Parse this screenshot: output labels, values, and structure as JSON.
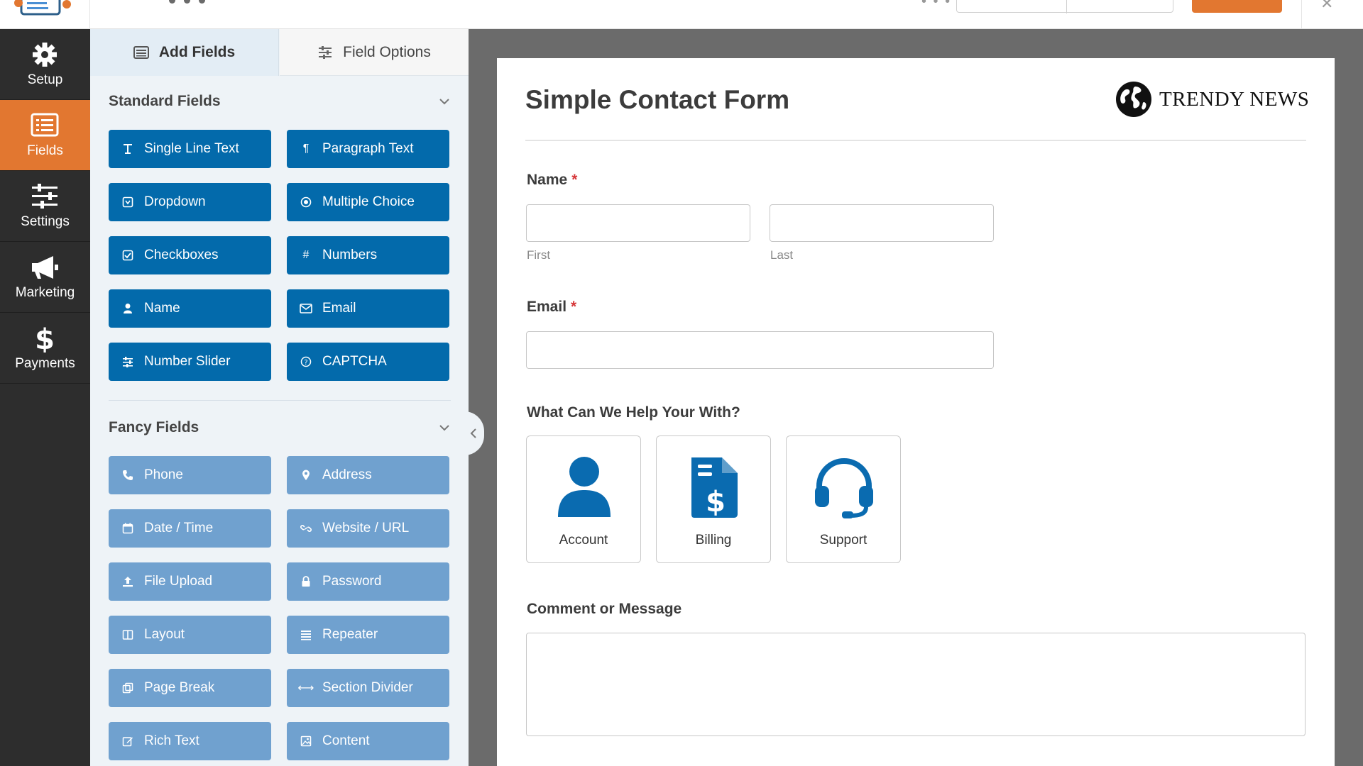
{
  "nav": {
    "items": [
      {
        "label": "Setup",
        "icon": "gear-icon"
      },
      {
        "label": "Fields",
        "icon": "list-icon",
        "active": true
      },
      {
        "label": "Settings",
        "icon": "sliders-icon"
      },
      {
        "label": "Marketing",
        "icon": "megaphone-icon"
      },
      {
        "label": "Payments",
        "icon": "dollar-icon"
      }
    ]
  },
  "panel": {
    "tabs": {
      "add_fields": "Add Fields",
      "field_options": "Field Options"
    },
    "standard": {
      "title": "Standard Fields",
      "fields": [
        "Single Line Text",
        "Paragraph Text",
        "Dropdown",
        "Multiple Choice",
        "Checkboxes",
        "Numbers",
        "Name",
        "Email",
        "Number Slider",
        "CAPTCHA"
      ]
    },
    "fancy": {
      "title": "Fancy Fields",
      "fields": [
        "Phone",
        "Address",
        "Date / Time",
        "Website / URL",
        "File Upload",
        "Password",
        "Layout",
        "Repeater",
        "Page Break",
        "Section Divider",
        "Rich Text",
        "Content"
      ]
    }
  },
  "form": {
    "title": "Simple Contact Form",
    "brand": "TRENDY NEWS",
    "name_label": "Name",
    "required_mark": "*",
    "first_sublabel": "First",
    "last_sublabel": "Last",
    "email_label": "Email",
    "help_label": "What Can We Help Your With?",
    "choices": [
      {
        "label": "Account",
        "icon": "user-icon"
      },
      {
        "label": "Billing",
        "icon": "invoice-dollar-icon"
      },
      {
        "label": "Support",
        "icon": "headset-icon"
      }
    ],
    "comment_label": "Comment or Message"
  },
  "colors": {
    "accent_orange": "#e27730",
    "standard_button": "#036aab",
    "fancy_button": "#70a1cf",
    "nav_bg": "#2d2d2d",
    "panel_bg": "#eef3f7"
  }
}
